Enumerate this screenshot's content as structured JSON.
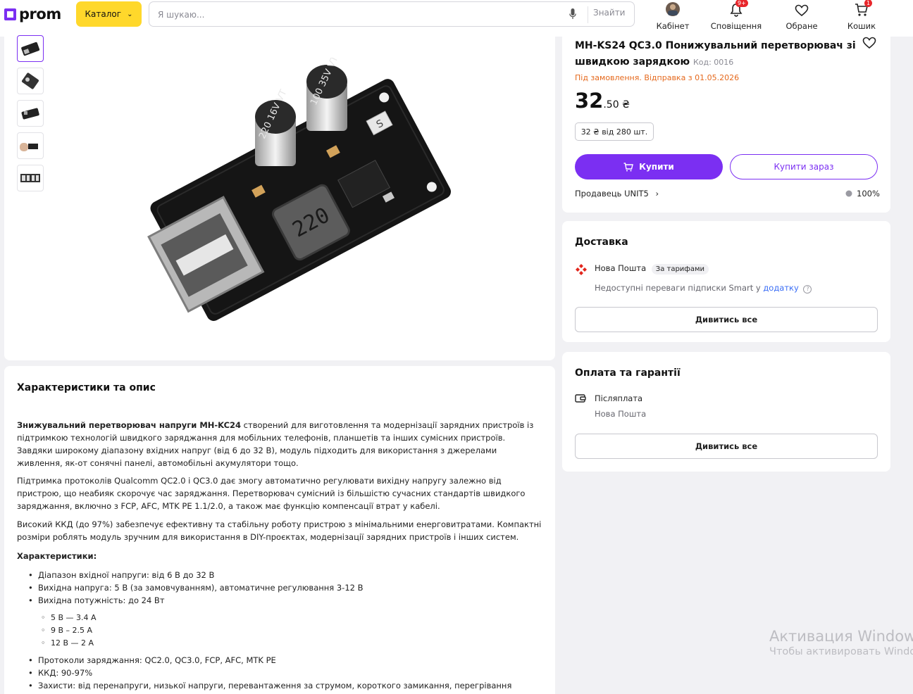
{
  "header": {
    "logo": "prom",
    "catalog": "Каталог",
    "search_placeholder": "Я шукаю...",
    "search_button": "Знайти",
    "nav": {
      "cabinet": "Кабінет",
      "notifications": "Сповіщення",
      "notifications_badge": "9+",
      "favorites": "Обране",
      "cart": "Кошик",
      "cart_badge": "1"
    }
  },
  "product": {
    "title": "MH-KS24 QC3.0 Понижувальний перетворювач зі швидкою зарядкою",
    "code": "Код: 0016",
    "availability": "Під замовлення. Відправка з 01.05.2026",
    "price_main": "32",
    "price_rest": ".50 ₴",
    "wholesale": "32 ₴ від 280 шт.",
    "buy": "Купити",
    "buy_now": "Купити зараз",
    "seller": "Продавець UNIT5",
    "rating": "100%",
    "thumbnails": 5,
    "image_markings": {
      "cap1": "100\n35V\nVT",
      "cap2": "220\n16V\nVT",
      "inductor": "220",
      "chip": "S"
    }
  },
  "delivery": {
    "title": "Доставка",
    "carrier": "Нова Пошта",
    "tariff_tag": "За тарифами",
    "note_prefix": "Недоступні переваги підписки Smart у",
    "note_link": "додатку",
    "view_all": "Дивитись все"
  },
  "payment": {
    "title": "Оплата та гарантії",
    "method": "Післяплата",
    "method_sub": "Нова Пошта",
    "view_all": "Дивитись все"
  },
  "description": {
    "title": "Характеристики та опис",
    "p1_bold": "Знижувальний перетворювач напруги MH-KC24",
    "p1_rest": " створений для виготовлення та модернізації зарядних пристроїв із підтримкою технологій швидкого заряджання для мобільних телефонів, планшетів та інших сумісних пристроїв. Завдяки широкому діапазону вхідних напруг (від 6 до 32 В), модуль підходить для використання з джерелами живлення, як-от сонячні панелі, автомобільні акумулятори тощо.",
    "p2": "Підтримка протоколів Qualcomm QC2.0 і QC3.0 дає змогу автоматично регулювати вихідну напругу залежно від пристрою, що неабияк скорочує час заряджання. Перетворювач сумісний із більшістю сучасних стандартів швидкого заряджання, включно з FCP, AFC, MTK PE 1.1/2.0, а також має функцію компенсації втрат у кабелі.",
    "p3": "Високий ККД (до 97%) забезпечує ефективну та стабільну роботу пристрою з мінімальними енерговитратами. Компактні розміри роблять модуль зручним для використання в DIY-проєктах, модернізації зарядних пристроїв і інших систем.",
    "specs_title": "Характеристики:",
    "specs": [
      "Діапазон вхідної напруги: від 6 В до 32 В",
      "Вихідна напруга: 5 В (за замовчуванням), автоматичне регулювання 3-12 В",
      "Вихідна потужність: до 24 Вт"
    ],
    "sub_specs": [
      "5 В — 3.4 А",
      "9 В – 2.5 А",
      "12 В — 2 А"
    ],
    "specs2": [
      "Протоколи заряджання: QC2.0, QC3.0, FCP, AFC, MTK PE",
      "ККД: 90-97%",
      "Захисти: від перенапруги, низької напруги, перевантаження за струмом, короткого замикання, перегрівання"
    ]
  },
  "watermark": {
    "line1": "Активация Windows",
    "line2": "Чтобы активировать Windows"
  }
}
